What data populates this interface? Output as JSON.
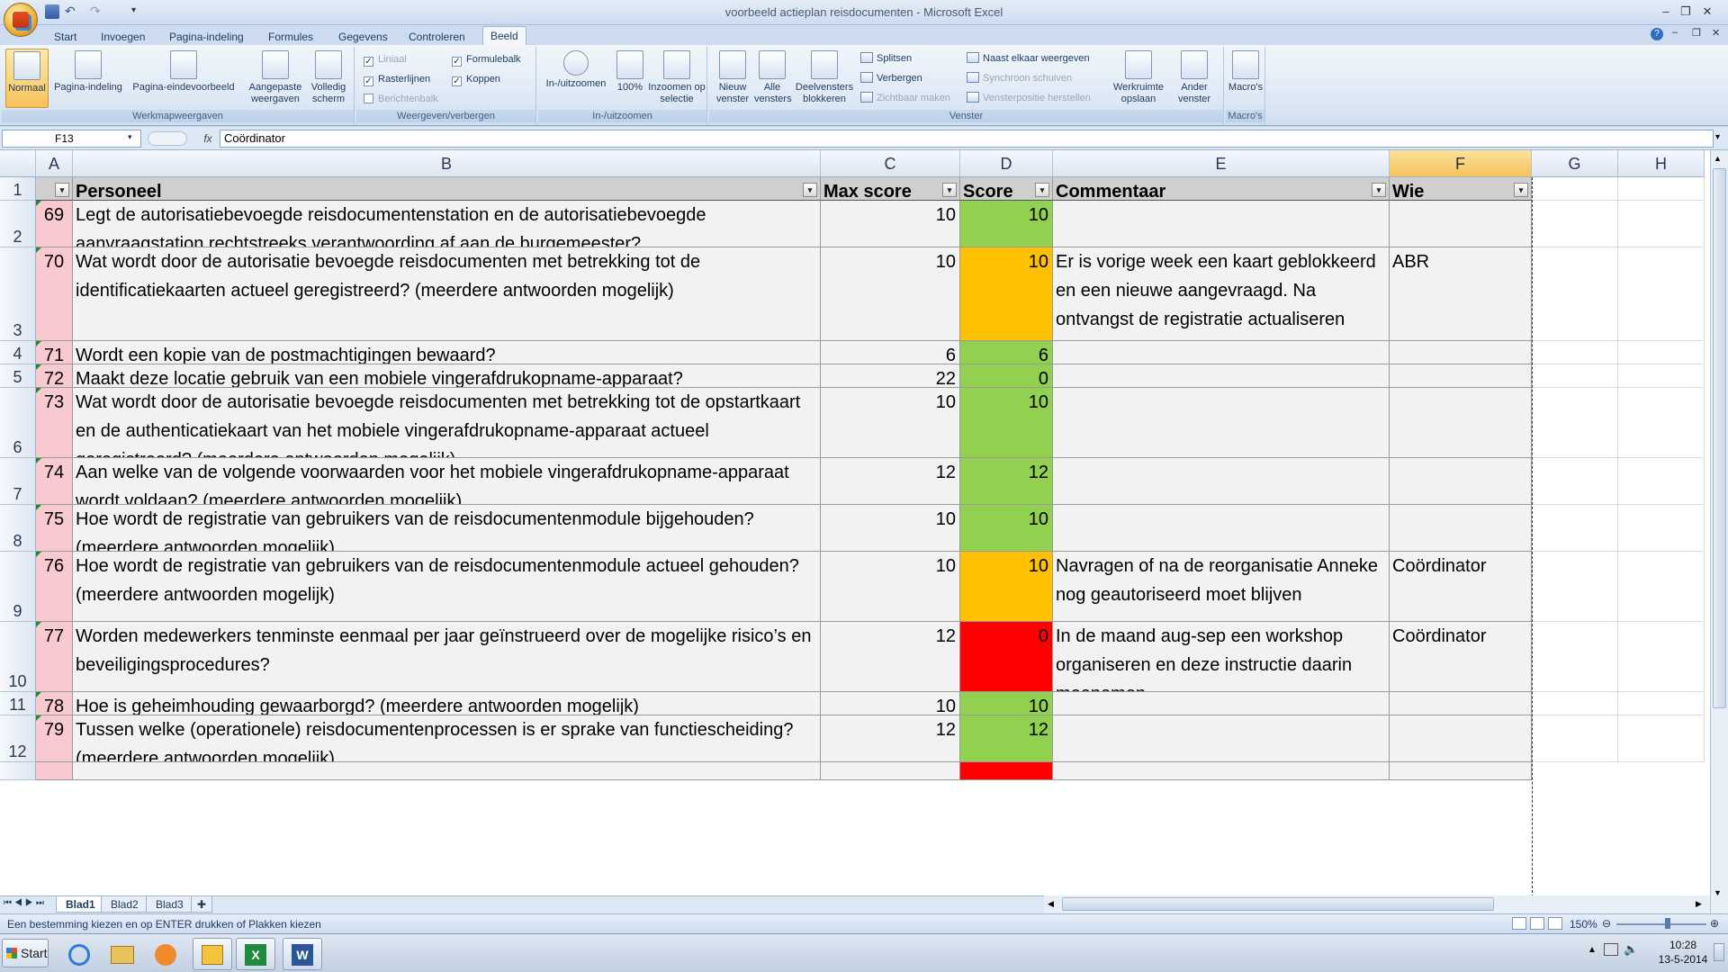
{
  "window": {
    "title": "voorbeeld actieplan reisdocumenten - Microsoft Excel"
  },
  "tabs": [
    "Start",
    "Invoegen",
    "Pagina-indeling",
    "Formules",
    "Gegevens",
    "Controleren",
    "Beeld"
  ],
  "active_tab": "Beeld",
  "ribbon": {
    "workbook_views": {
      "label": "Werkmapweergaven",
      "buttons": [
        "Normaal",
        "Pagina-indeling",
        "Pagina-eindevoorbeeld",
        "Aangepaste weergaven",
        "Volledig scherm"
      ]
    },
    "show_hide": {
      "label": "Weergeven/verbergen",
      "checks": [
        {
          "text": "Liniaal",
          "checked": true,
          "disabled": true
        },
        {
          "text": "Rasterlijnen",
          "checked": true,
          "disabled": false
        },
        {
          "text": "Berichtenbalk",
          "checked": false,
          "disabled": true
        },
        {
          "text": "Formulebalk",
          "checked": true,
          "disabled": false
        },
        {
          "text": "Koppen",
          "checked": true,
          "disabled": false
        }
      ]
    },
    "zoom": {
      "label": "In-/uitzoomen",
      "buttons": [
        "In-/uitzoomen",
        "100%",
        "Inzoomen op selectie"
      ]
    },
    "window_group": {
      "label": "Venster",
      "buttons": [
        "Nieuw venster",
        "Alle vensters",
        "Deelvensters blokkeren"
      ],
      "small": [
        {
          "text": "Splitsen",
          "disabled": false
        },
        {
          "text": "Verbergen",
          "disabled": false
        },
        {
          "text": "Zichtbaar maken",
          "disabled": true
        },
        {
          "text": "Naast elkaar weergeven",
          "disabled": false
        },
        {
          "text": "Synchroon schuiven",
          "disabled": true
        },
        {
          "text": "Vensterpositie herstellen",
          "disabled": true
        }
      ],
      "big2": [
        "Werkruimte opslaan",
        "Ander venster"
      ]
    },
    "macros": {
      "label": "Macro's",
      "button": "Macro's"
    }
  },
  "formula_bar": {
    "name_box": "F13",
    "fx": "fx",
    "value": "Coördinator"
  },
  "columns": [
    "A",
    "B",
    "C",
    "D",
    "E",
    "F",
    "G",
    "H"
  ],
  "header_row": {
    "row": "1",
    "a": "",
    "b": "Personeel",
    "c": "Max score",
    "d": "Score",
    "e": "Commentaar",
    "f": "Wie"
  },
  "rows": [
    {
      "row": "2",
      "a": "69",
      "b": "Legt de autorisatiebevoegde reisdocumentenstation en de autorisatiebevoegde aanvraagstation  rechtstreeks verantwoording af aan de burgemeester?",
      "c": "10",
      "d": "10",
      "status": "green",
      "e": "",
      "f": ""
    },
    {
      "row": "3",
      "a": "70",
      "b": "Wat wordt door de autorisatie bevoegde reisdocumenten met betrekking tot de identificatiekaarten actueel geregistreerd? (meerdere antwoorden mogelijk)",
      "c": "10",
      "d": "10",
      "status": "orange",
      "e": "Er is vorige week een kaart geblokkeerd en een nieuwe aangevraagd. Na ontvangst de registratie actualiseren",
      "f": "ABR"
    },
    {
      "row": "4",
      "a": "71",
      "b": "Wordt een kopie van de postmachtigingen bewaard?",
      "c": "6",
      "d": "6",
      "status": "green",
      "e": "",
      "f": ""
    },
    {
      "row": "5",
      "a": "72",
      "b": "Maakt deze locatie gebruik van een mobiele vingerafdrukopname-apparaat?",
      "c": "22",
      "d": "0",
      "status": "green",
      "e": "",
      "f": ""
    },
    {
      "row": "6",
      "a": "73",
      "b": "Wat wordt door de autorisatie bevoegde reisdocumenten met betrekking tot de opstartkaart en de authenticatiekaart van het mobiele vingerafdrukopname-apparaat actueel geregistreerd? (meerdere antwoorden mogelijk)",
      "c": "10",
      "d": "10",
      "status": "green",
      "e": "",
      "f": ""
    },
    {
      "row": "7",
      "a": "74",
      "b": "Aan welke van de volgende voorwaarden voor het mobiele vingerafdrukopname-apparaat wordt voldaan? (meerdere antwoorden mogelijk)",
      "c": "12",
      "d": "12",
      "status": "green",
      "e": "",
      "f": ""
    },
    {
      "row": "8",
      "a": "75",
      "b": "Hoe wordt de registratie van gebruikers van de reisdocumentenmodule bijgehouden? (meerdere antwoorden mogelijk)",
      "c": "10",
      "d": "10",
      "status": "green",
      "e": "",
      "f": ""
    },
    {
      "row": "9",
      "a": "76",
      "b": "Hoe wordt de registratie van gebruikers van de reisdocumentenmodule actueel gehouden? (meerdere antwoorden mogelijk)",
      "c": "10",
      "d": "10",
      "status": "orange",
      "e": "Navragen of na de reorganisatie Anneke nog geautoriseerd moet blijven",
      "f": "Coördinator"
    },
    {
      "row": "10",
      "a": "77",
      "b": "Worden medewerkers tenminste eenmaal per jaar geïnstrueerd over de mogelijke risico’s en beveiligingsprocedures?",
      "c": "12",
      "d": "0",
      "status": "red",
      "e": "In de maand aug-sep een workshop organiseren en deze instructie daarin meenemen",
      "f": "Coördinator"
    },
    {
      "row": "11",
      "a": "78",
      "b": "Hoe is geheimhouding gewaarborgd? (meerdere antwoorden mogelijk)",
      "c": "10",
      "d": "10",
      "status": "green",
      "e": "",
      "f": ""
    },
    {
      "row": "12",
      "a": "79",
      "b": "Tussen welke (operationele) reisdocumentenprocessen is er sprake van functiescheiding? (meerdere antwoorden mogelijk)",
      "c": "12",
      "d": "12",
      "status": "green",
      "e": "",
      "f": ""
    }
  ],
  "sheets": [
    "Blad1",
    "Blad2",
    "Blad3"
  ],
  "active_sheet": "Blad1",
  "status_bar": {
    "message": "Een bestemming kiezen en op ENTER drukken of Plakken kiezen",
    "zoom": "150%"
  },
  "taskbar": {
    "start": "Start",
    "time": "10:28",
    "date": "13-5-2014"
  },
  "colors": {
    "green": "#92d050",
    "orange": "#ffc000",
    "red": "#ff0000",
    "pink": "#f9c9d0",
    "selected_col": "#f6c25a"
  }
}
